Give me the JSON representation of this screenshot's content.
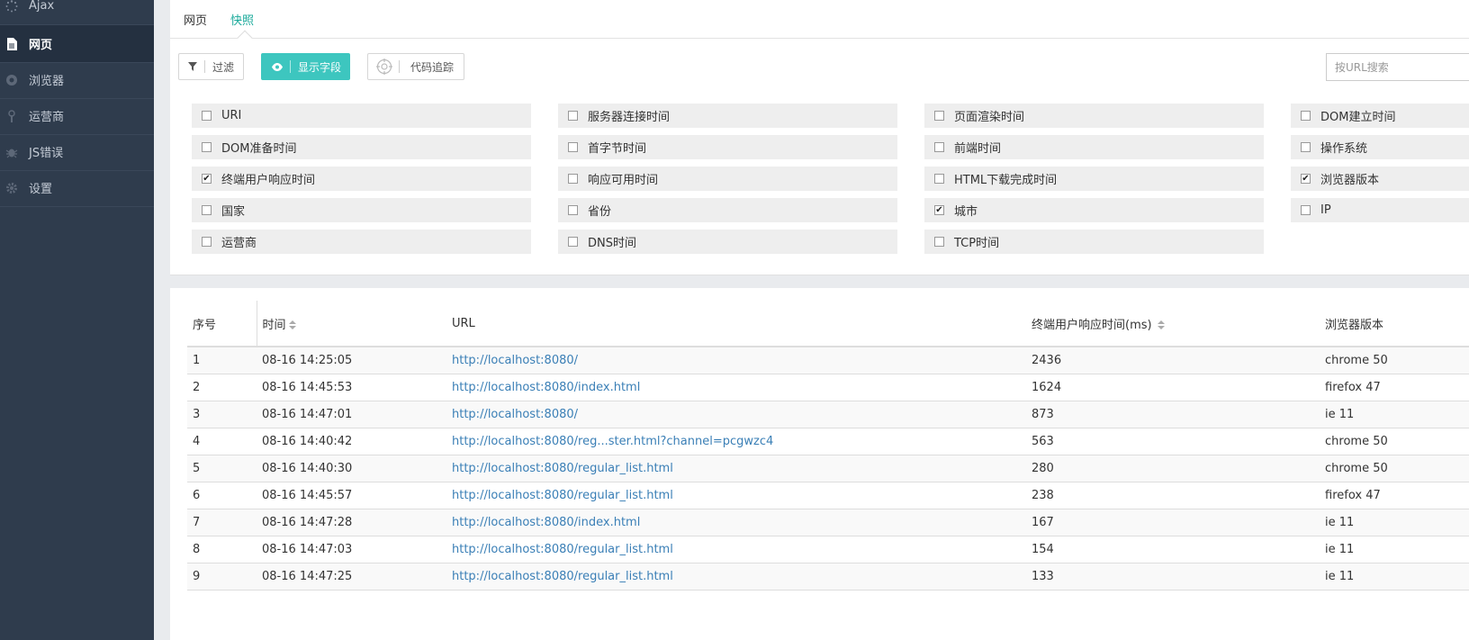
{
  "sidebar": {
    "items": [
      {
        "label": "Ajax",
        "icon": "spinner-icon"
      },
      {
        "label": "网页",
        "icon": "document-icon",
        "active": true
      },
      {
        "label": "浏览器",
        "icon": "browser-icon"
      },
      {
        "label": "运营商",
        "icon": "signal-icon"
      },
      {
        "label": "JS错误",
        "icon": "bug-icon"
      },
      {
        "label": "设置",
        "icon": "gear-icon"
      }
    ]
  },
  "tabs": [
    {
      "label": "网页"
    },
    {
      "label": "快照",
      "active": true
    }
  ],
  "toolbar": {
    "filter_label": "过滤",
    "show_fields_label": "显示字段",
    "code_trace_label": "代码追踪",
    "search_placeholder": "按URL搜索"
  },
  "fields": [
    {
      "label": "URI",
      "checked": false
    },
    {
      "label": "服务器连接时间",
      "checked": false
    },
    {
      "label": "页面渲染时间",
      "checked": false
    },
    {
      "label": "DOM建立时间",
      "checked": false
    },
    {
      "label": "DOM准备时间",
      "checked": false
    },
    {
      "label": "首字节时间",
      "checked": false
    },
    {
      "label": "前端时间",
      "checked": false
    },
    {
      "label": "操作系统",
      "checked": false
    },
    {
      "label": "终端用户响应时间",
      "checked": true
    },
    {
      "label": "响应可用时间",
      "checked": false
    },
    {
      "label": "HTML下载完成时间",
      "checked": false
    },
    {
      "label": "浏览器版本",
      "checked": true
    },
    {
      "label": "国家",
      "checked": false
    },
    {
      "label": "省份",
      "checked": false
    },
    {
      "label": "城市",
      "checked": true
    },
    {
      "label": "IP",
      "checked": false
    },
    {
      "label": "运营商",
      "checked": false
    },
    {
      "label": "DNS时间",
      "checked": false
    },
    {
      "label": "TCP时间",
      "checked": false
    }
  ],
  "table": {
    "headers": {
      "index": "序号",
      "time": "时间",
      "url": "URL",
      "response": "终端用户响应时间(ms)",
      "browser": "浏览器版本"
    },
    "rows": [
      {
        "index": "1",
        "time": "08-16 14:25:05",
        "url": "http://localhost:8080/",
        "response": "2436",
        "browser": "chrome 50"
      },
      {
        "index": "2",
        "time": "08-16 14:45:53",
        "url": "http://localhost:8080/index.html",
        "response": "1624",
        "browser": "firefox 47"
      },
      {
        "index": "3",
        "time": "08-16 14:47:01",
        "url": "http://localhost:8080/",
        "response": "873",
        "browser": "ie 11"
      },
      {
        "index": "4",
        "time": "08-16 14:40:42",
        "url": "http://localhost:8080/reg...ster.html?channel=pcgwzc4",
        "response": "563",
        "browser": "chrome 50"
      },
      {
        "index": "5",
        "time": "08-16 14:40:30",
        "url": "http://localhost:8080/regular_list.html",
        "response": "280",
        "browser": "chrome 50"
      },
      {
        "index": "6",
        "time": "08-16 14:45:57",
        "url": "http://localhost:8080/regular_list.html",
        "response": "238",
        "browser": "firefox 47"
      },
      {
        "index": "7",
        "time": "08-16 14:47:28",
        "url": "http://localhost:8080/index.html",
        "response": "167",
        "browser": "ie 11"
      },
      {
        "index": "8",
        "time": "08-16 14:47:03",
        "url": "http://localhost:8080/regular_list.html",
        "response": "154",
        "browser": "ie 11"
      },
      {
        "index": "9",
        "time": "08-16 14:47:25",
        "url": "http://localhost:8080/regular_list.html",
        "response": "133",
        "browser": "ie 11"
      }
    ]
  },
  "colors": {
    "sidebar_bg": "#2f3c4d",
    "accent_teal": "#3dc6bf",
    "tab_active": "#1aaa9b",
    "link": "#3a7fb6"
  }
}
